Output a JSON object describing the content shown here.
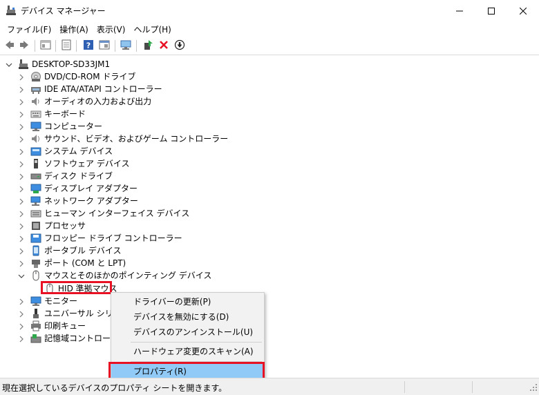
{
  "window": {
    "title": "デバイス マネージャー",
    "controls": [
      "minimize-icon",
      "maximize-icon",
      "close-icon"
    ]
  },
  "menu": {
    "items": [
      "ファイル(F)",
      "操作(A)",
      "表示(V)",
      "ヘルプ(H)"
    ]
  },
  "toolbar": {
    "buttons": [
      "back-icon",
      "forward-icon",
      "show-hide-tree-icon",
      "properties-icon",
      "help-icon",
      "show-hidden-icon",
      "scan-hardware-icon",
      "update-driver-icon",
      "uninstall-icon",
      "disable-icon"
    ]
  },
  "tree": {
    "root": "DESKTOP-SD33JM1",
    "categories": [
      "DVD/CD-ROM ドライブ",
      "IDE ATA/ATAPI コントローラー",
      "オーディオの入力および出力",
      "キーボード",
      "コンピューター",
      "サウンド、ビデオ、およびゲーム コントローラー",
      "システム デバイス",
      "ソフトウェア デバイス",
      "ディスク ドライブ",
      "ディスプレイ アダプター",
      "ネットワーク アダプター",
      "ヒューマン インターフェイス デバイス",
      "プロセッサ",
      "フロッピー ドライブ コントローラー",
      "ポータブル デバイス",
      "ポート (COM と LPT)",
      "マウスとそのほかのポインティング デバイス"
    ],
    "selected_child": "HID 準拠マウス",
    "after": [
      "モニター",
      "ユニバーサル シリアル",
      "印刷キュー",
      "記憶域コントローラー"
    ]
  },
  "context_menu": {
    "items": [
      "ドライバーの更新(P)",
      "デバイスを無効にする(D)",
      "デバイスのアンインストール(U)",
      "ハードウェア変更のスキャン(A)",
      "プロパティ(R)"
    ]
  },
  "status": {
    "text": "現在選択しているデバイスのプロパティ シートを開きます。"
  },
  "colors": {
    "highlight": "#91c9f7",
    "annotation": "#e81123",
    "disable_x": "#e81123"
  }
}
